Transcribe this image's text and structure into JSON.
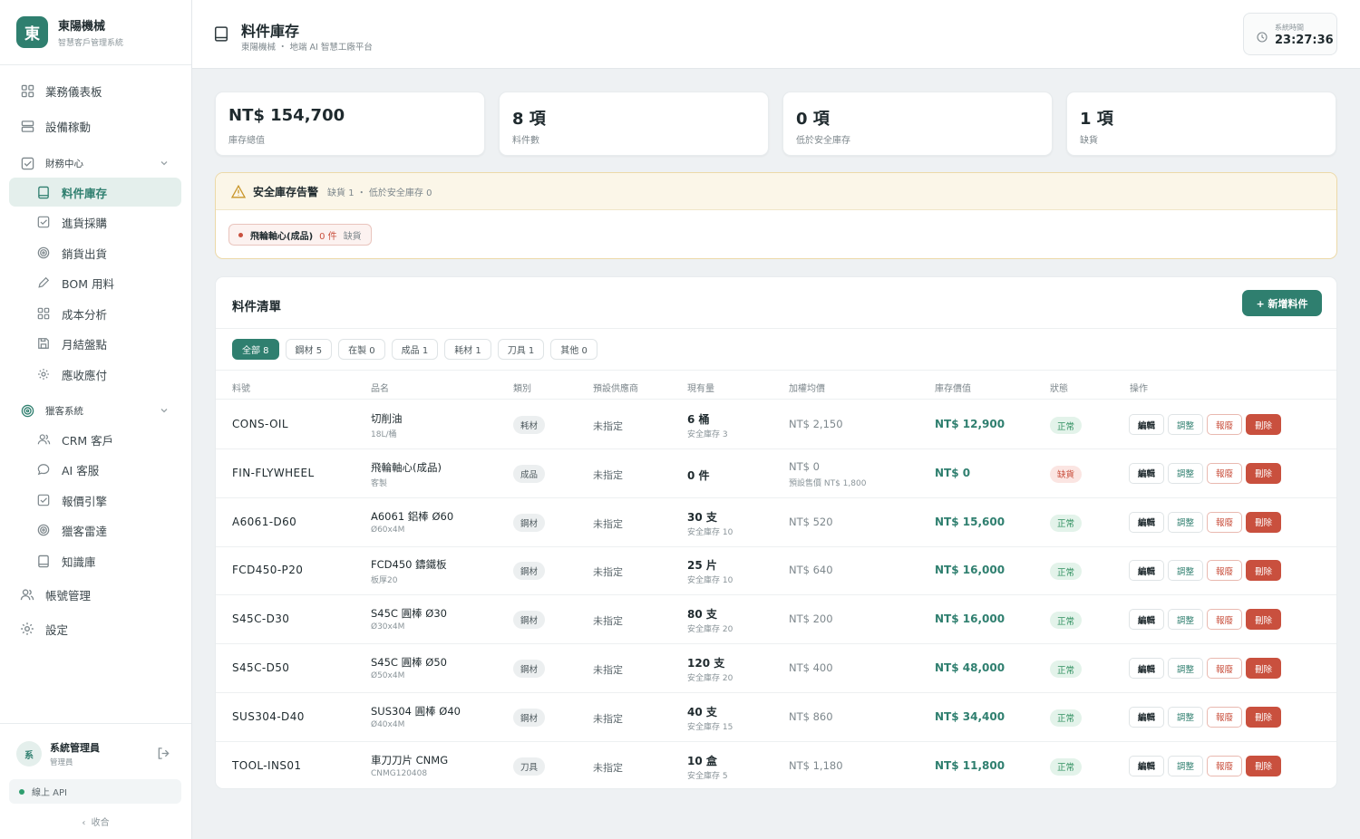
{
  "brand": {
    "logo": "東",
    "name": "東陽機械",
    "subtitle": "智慧客戶管理系統"
  },
  "nav": {
    "dashboard": "業務儀表板",
    "equipment": "設備稼動",
    "finance_group": "財務中心",
    "finance_items": [
      "料件庫存",
      "進貨採購",
      "銷貨出貨",
      "BOM 用料",
      "成本分析",
      "月結盤點",
      "應收應付"
    ],
    "crm_group": "獵客系統",
    "crm_items": [
      "CRM 客戶",
      "AI 客服",
      "報價引擎",
      "獵客雷達",
      "知識庫"
    ],
    "accounts": "帳號管理",
    "settings": "設定"
  },
  "user": {
    "initial": "系",
    "name": "系統管理員",
    "role": "管理員"
  },
  "api_status": "線上 API",
  "collapse_label": "收合",
  "header": {
    "title": "料件庫存",
    "subtitle": "東陽機械 ・ 地端 AI 智慧工廠平台",
    "clock_label": "系統時間",
    "clock_time": "23:27:36"
  },
  "stats": [
    {
      "value": "NT$ 154,700",
      "label": "庫存總值"
    },
    {
      "value": "8 項",
      "label": "料件數"
    },
    {
      "value": "0 項",
      "label": "低於安全庫存"
    },
    {
      "value": "1 項",
      "label": "缺貨"
    }
  ],
  "alert": {
    "title": "安全庫存告警",
    "summary": "缺貨 1 ・ 低於安全庫存 0",
    "chip": {
      "name": "飛輪軸心(成品)",
      "qty": "0 件",
      "status": "缺貨"
    }
  },
  "table": {
    "title": "料件清單",
    "add_button": "+ 新增料件",
    "filters": [
      "全部 8",
      "鋼材 5",
      "在製 0",
      "成品 1",
      "耗材 1",
      "刀具 1",
      "其他 0"
    ],
    "headers": [
      "料號",
      "品名",
      "類別",
      "預設供應商",
      "現有量",
      "加權均價",
      "庫存價值",
      "狀態",
      "操作"
    ],
    "actions": {
      "edit": "編輯",
      "adjust": "調整",
      "scrap": "報廢",
      "delete": "刪除"
    },
    "rows": [
      {
        "code": "CONS-OIL",
        "name": "切削油",
        "spec": "18L/桶",
        "category": "耗材",
        "supplier": "未指定",
        "qty": "6 桶",
        "safety": "安全庫存 3",
        "avg": "NT$ 2,150",
        "avg_note": "",
        "value": "NT$ 12,900",
        "status": "正常"
      },
      {
        "code": "FIN-FLYWHEEL",
        "name": "飛輪軸心(成品)",
        "spec": "客製",
        "category": "成品",
        "supplier": "未指定",
        "qty": "0 件",
        "safety": "",
        "avg": "NT$ 0",
        "avg_note": "預設售價 NT$ 1,800",
        "value": "NT$ 0",
        "status": "缺貨"
      },
      {
        "code": "A6061-D60",
        "name": "A6061 鋁棒 Ø60",
        "spec": "Ø60x4M",
        "category": "鋼材",
        "supplier": "未指定",
        "qty": "30 支",
        "safety": "安全庫存 10",
        "avg": "NT$ 520",
        "avg_note": "",
        "value": "NT$ 15,600",
        "status": "正常"
      },
      {
        "code": "FCD450-P20",
        "name": "FCD450 鑄鐵板",
        "spec": "板厚20",
        "category": "鋼材",
        "supplier": "未指定",
        "qty": "25 片",
        "safety": "安全庫存 10",
        "avg": "NT$ 640",
        "avg_note": "",
        "value": "NT$ 16,000",
        "status": "正常"
      },
      {
        "code": "S45C-D30",
        "name": "S45C 圓棒 Ø30",
        "spec": "Ø30x4M",
        "category": "鋼材",
        "supplier": "未指定",
        "qty": "80 支",
        "safety": "安全庫存 20",
        "avg": "NT$ 200",
        "avg_note": "",
        "value": "NT$ 16,000",
        "status": "正常"
      },
      {
        "code": "S45C-D50",
        "name": "S45C 圓棒 Ø50",
        "spec": "Ø50x4M",
        "category": "鋼材",
        "supplier": "未指定",
        "qty": "120 支",
        "safety": "安全庫存 20",
        "avg": "NT$ 400",
        "avg_note": "",
        "value": "NT$ 48,000",
        "status": "正常"
      },
      {
        "code": "SUS304-D40",
        "name": "SUS304 圓棒 Ø40",
        "spec": "Ø40x4M",
        "category": "鋼材",
        "supplier": "未指定",
        "qty": "40 支",
        "safety": "安全庫存 15",
        "avg": "NT$ 860",
        "avg_note": "",
        "value": "NT$ 34,400",
        "status": "正常"
      },
      {
        "code": "TOOL-INS01",
        "name": "車刀刀片 CNMG",
        "spec": "CNMG120408",
        "category": "刀具",
        "supplier": "未指定",
        "qty": "10 盒",
        "safety": "安全庫存 5",
        "avg": "NT$ 1,180",
        "avg_note": "",
        "value": "NT$ 11,800",
        "status": "正常"
      }
    ]
  },
  "colors": {
    "accent": "#2f7f6f",
    "danger": "#c9503e",
    "warning": "#c9962a"
  }
}
